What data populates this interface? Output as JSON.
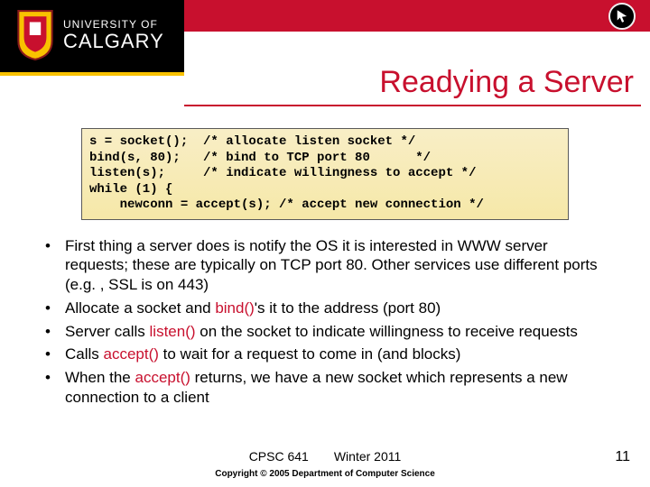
{
  "logo": {
    "university_of": "UNIVERSITY OF",
    "calgary": "CALGARY"
  },
  "title": "Readying a Server",
  "icon_name": "cursor-icon",
  "code": "s = socket();  /* allocate listen socket */\nbind(s, 80);   /* bind to TCP port 80      */\nlisten(s);     /* indicate willingness to accept */\nwhile (1) {\n    newconn = accept(s); /* accept new connection */",
  "bullets": [
    {
      "parts": [
        {
          "t": "First thing a server does is notify the OS it is interested in WWW server requests; these are typically on TCP port 80. Other services use different ports (e.g. , SSL is on 443)"
        }
      ]
    },
    {
      "parts": [
        {
          "t": "Allocate a socket and "
        },
        {
          "t": "bind()",
          "red": true
        },
        {
          "t": "'s it to the address (port 80)"
        }
      ]
    },
    {
      "parts": [
        {
          "t": "Server calls "
        },
        {
          "t": "listen()",
          "red": true
        },
        {
          "t": " on the socket to indicate willingness to receive requests"
        }
      ]
    },
    {
      "parts": [
        {
          "t": "Calls "
        },
        {
          "t": "accept()",
          "red": true
        },
        {
          "t": " to wait for a request to come in (and blocks)"
        }
      ]
    },
    {
      "parts": [
        {
          "t": "When the "
        },
        {
          "t": "accept()",
          "red": true
        },
        {
          "t": " returns, we have a new socket which represents a new connection to a client"
        }
      ]
    }
  ],
  "footer": {
    "course": "CPSC 641",
    "term": "Winter 2011",
    "page": "11",
    "copyright": "Copyright © 2005 Department of Computer Science"
  }
}
